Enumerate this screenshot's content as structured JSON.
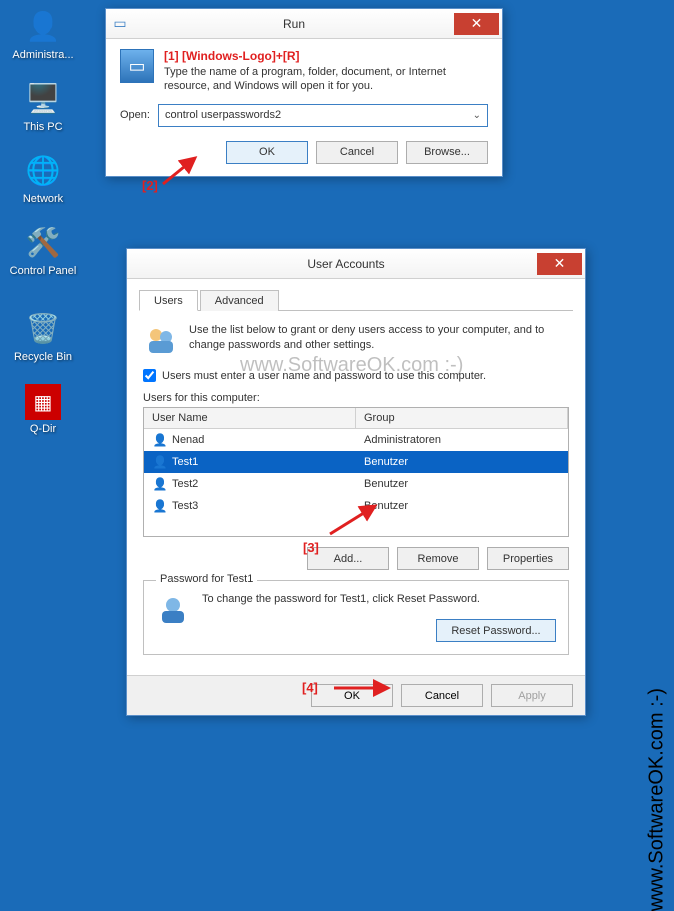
{
  "desktop": {
    "icons": [
      {
        "label": "Administra...",
        "glyph": "👤"
      },
      {
        "label": "This PC",
        "glyph": "🖥"
      },
      {
        "label": "Network",
        "glyph": "🌐"
      },
      {
        "label": "Control Panel",
        "glyph": "⚙"
      },
      {
        "label": "Recycle Bin",
        "glyph": "🗑"
      },
      {
        "label": "Q-Dir",
        "glyph": "▦"
      }
    ]
  },
  "run": {
    "title": "Run",
    "annot1": "[1] [Windows-Logo]+[R]",
    "desc": "Type the name of a program, folder, document, or Internet resource, and Windows will open it for you.",
    "open_label": "Open:",
    "open_value": "control userpasswords2",
    "annot2": "[2]",
    "ok": "OK",
    "cancel": "Cancel",
    "browse": "Browse..."
  },
  "ua": {
    "title": "User Accounts",
    "tabs": {
      "users": "Users",
      "advanced": "Advanced"
    },
    "intro": "Use the list below to grant or deny users access to your computer, and to change passwords and other settings.",
    "check_label": "Users must enter a user name and password to use this computer.",
    "check_value": true,
    "list_label": "Users for this computer:",
    "cols": {
      "name": "User Name",
      "group": "Group"
    },
    "rows": [
      {
        "name": "Nenad",
        "group": "Administratoren",
        "sel": false
      },
      {
        "name": "Test1",
        "group": "Benutzer",
        "sel": true
      },
      {
        "name": "Test2",
        "group": "Benutzer",
        "sel": false
      },
      {
        "name": "Test3",
        "group": "Benutzer",
        "sel": false
      }
    ],
    "annot3": "[3]",
    "add": "Add...",
    "remove": "Remove",
    "properties": "Properties",
    "fieldset_title": "Password for Test1",
    "fieldset_text": "To change the password for Test1, click Reset Password.",
    "annot4": "[4]",
    "reset": "Reset Password...",
    "ok": "OK",
    "cancel": "Cancel",
    "apply": "Apply"
  },
  "watermark": "www.SoftwareOK.com :-)"
}
